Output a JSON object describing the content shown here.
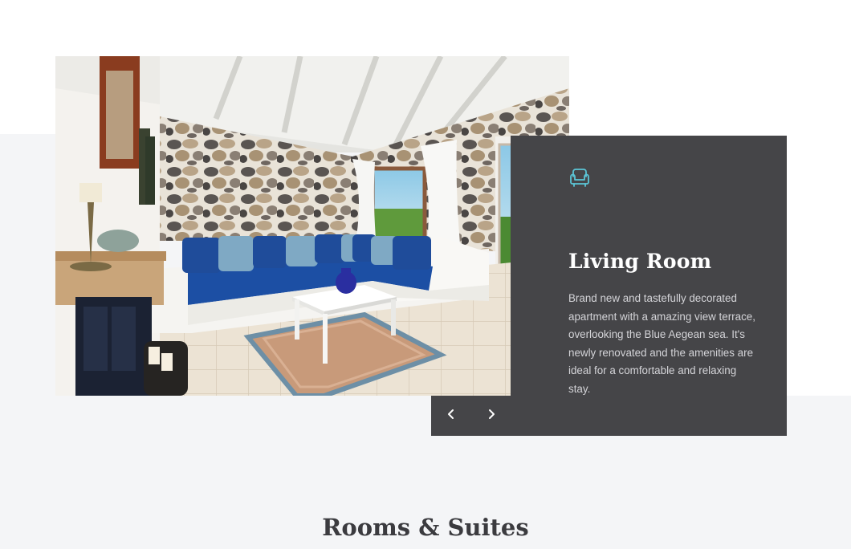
{
  "slider": {
    "photo": {
      "subject": "living-room-photo"
    },
    "card": {
      "icon": "armchair-icon",
      "title": "Living Room",
      "description": "Brand new and tastefully decorated apartment with a amazing view terrace, overlooking the Blue Aegean sea. It's newly renovated and the amenities are ideal for a comfortable and relaxing stay.",
      "accent_color": "#5bc5d6",
      "background_color": "#454548"
    },
    "controls": {
      "prev_icon": "chevron-left-icon",
      "next_icon": "chevron-right-icon"
    }
  },
  "section": {
    "title": "Rooms & Suites"
  }
}
